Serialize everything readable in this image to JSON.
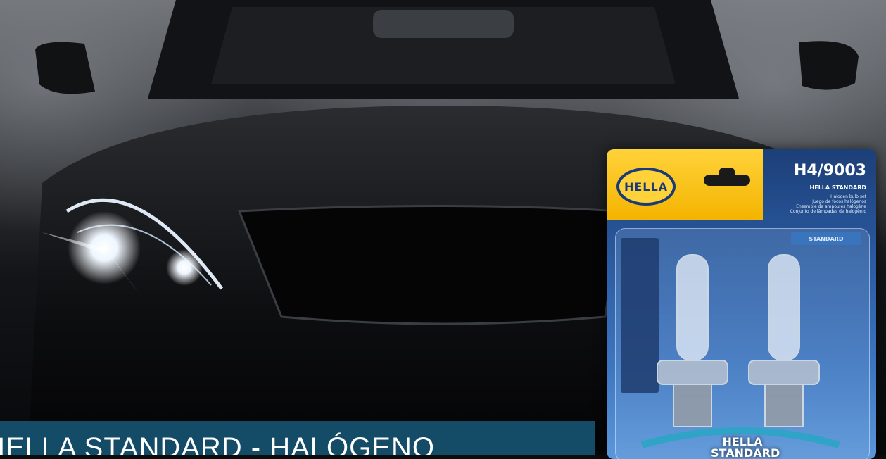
{
  "banner": {
    "title": "HELLA STANDARD - HALÓGENO"
  },
  "product": {
    "logo": "HELLA",
    "code": "H4/9003",
    "brand": "HELLA STANDARD",
    "description_lines": [
      "Halogen bulb set",
      "Juego de focos halógenos",
      "Ensemble de ampoules halogène",
      "Conjunto de lâmpadas de halogênio"
    ],
    "tag": "STANDARD",
    "bulb_label": "HELLA STANDARD"
  },
  "colors": {
    "banner": "#165370",
    "package_blue": "#2a5aa0",
    "package_yellow": "#f4b400",
    "headlight": "#ffffff"
  }
}
